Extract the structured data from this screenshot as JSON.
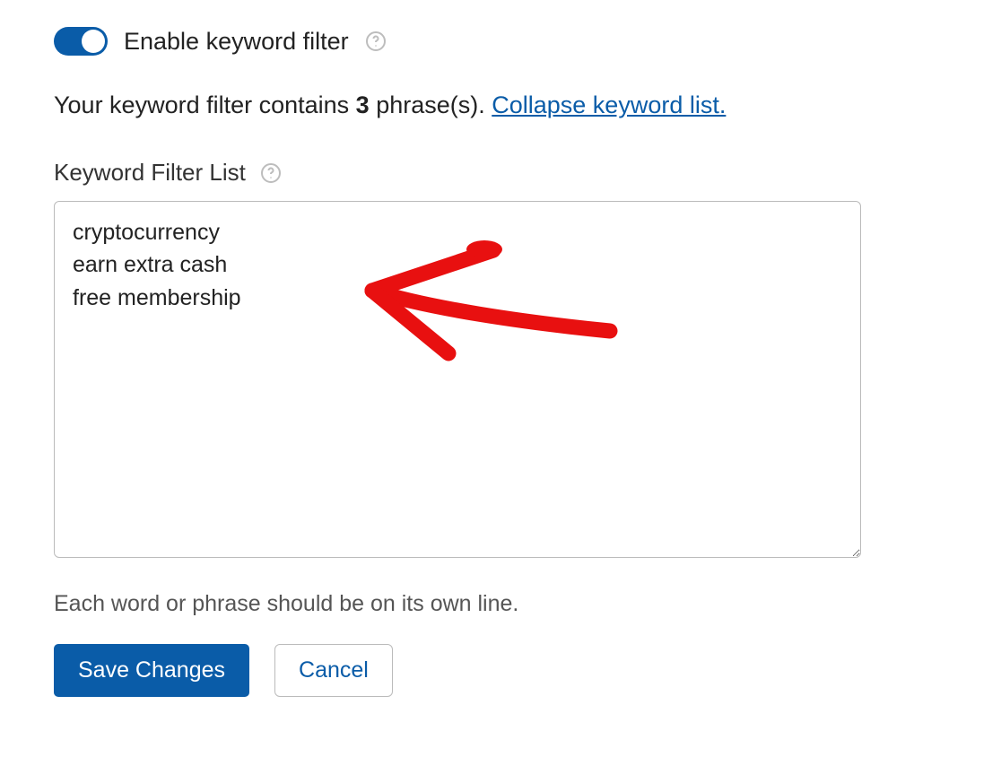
{
  "toggle": {
    "label": "Enable keyword filter",
    "enabled": true
  },
  "summary": {
    "prefix": "Your keyword filter contains ",
    "count": "3",
    "suffix": " phrase(s). ",
    "collapse_link": "Collapse keyword list."
  },
  "keyword_list": {
    "label": "Keyword Filter List",
    "value": "cryptocurrency\nearn extra cash\nfree membership",
    "helper": "Each word or phrase should be on its own line."
  },
  "buttons": {
    "save": "Save Changes",
    "cancel": "Cancel"
  },
  "icons": {
    "help": "help-circle-icon"
  },
  "colors": {
    "accent": "#0a5ca8",
    "annotation": "#e81010"
  }
}
